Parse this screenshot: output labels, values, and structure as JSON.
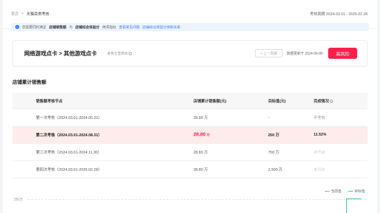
{
  "breadcrumb": {
    "root": "首页",
    "sep": ">",
    "current": "天猫目常考核"
  },
  "period": "考核周期 2024.03.01 - 2025.02.28",
  "notice": {
    "lead": "您需要同时满足",
    "req1": "店铺销售额",
    "mid": "与",
    "req2": "店铺综合体验分",
    "tail": "两项指标",
    "link1": "查看常见问题",
    "link2": "店铺综合体验分体制关系"
  },
  "card": {
    "title": "网络游戏点卡 > 其他游戏点卡",
    "subtitle": "考核主营类目",
    "prev_label": "< 上一周期",
    "updated": "数据更新于 2024-06-08",
    "risk": "高风险"
  },
  "section_title": "店铺累计销售额",
  "table": {
    "headers": [
      "销售额考核节点",
      "店铺累计销售额(元)",
      "目标值(元)",
      "完成情况"
    ],
    "rows": [
      {
        "node": "第一次考核（2024.03.01-2024.05.31）",
        "sales": "28.80 万",
        "target": "-",
        "status": "不考核",
        "highlight": false
      },
      {
        "node": "第二次考核（2024.03.01-2024.08.31）",
        "sales_num": "28.80",
        "sales_unit": "万",
        "target": "250 万",
        "status": "11.52%",
        "highlight": true
      },
      {
        "node": "第三次考核（2024.03.01-2024.11.30）",
        "sales": "28.80 万",
        "target": "750 万",
        "status": "未开启",
        "highlight": false
      },
      {
        "node": "第四次考核（2024.03.01-2025.02.28）",
        "sales": "28.80 万",
        "target": "2,500 万",
        "status": "未开启",
        "highlight": false
      }
    ]
  },
  "legend": {
    "current": "当前值",
    "target": "目标值"
  },
  "chart": {
    "ytick": "250万"
  },
  "colors": {
    "risk": "#ff1f4b",
    "link": "#3b7cff",
    "target_line": "#2ecc9a",
    "highlight_row": "#fdecea"
  }
}
